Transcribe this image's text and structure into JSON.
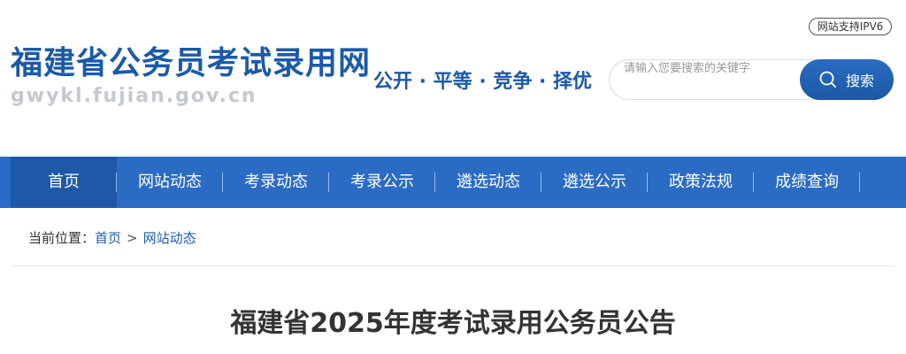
{
  "header": {
    "site_title": "福建省公务员考试录用网",
    "site_domain": "gwykl.fujian.gov.cn",
    "slogan": "公开 · 平等 · 竞争 · 择优",
    "ipv6_badge": "网站支持IPV6",
    "search": {
      "placeholder": "请输入您要搜索的关键字",
      "value": "",
      "button_label": "搜索",
      "button_icon": "search-icon"
    }
  },
  "nav": {
    "items": [
      {
        "label": "首页",
        "active": true
      },
      {
        "label": "网站动态",
        "active": false
      },
      {
        "label": "考录动态",
        "active": false
      },
      {
        "label": "考录公示",
        "active": false
      },
      {
        "label": "遴选动态",
        "active": false
      },
      {
        "label": "遴选公示",
        "active": false
      },
      {
        "label": "政策法规",
        "active": false
      },
      {
        "label": "成绩查询",
        "active": false
      }
    ]
  },
  "breadcrumb": {
    "prefix": "当前位置：",
    "items": [
      "首页",
      "网站动态"
    ],
    "separator": ">"
  },
  "article": {
    "title": "福建省2025年度考试录用公务员公告"
  },
  "colors": {
    "brand_blue": "#1b5aa8",
    "nav_bg": "#2a6bc4",
    "nav_active_bg": "#1d59a8",
    "domain_gray": "#c4c8cf"
  }
}
